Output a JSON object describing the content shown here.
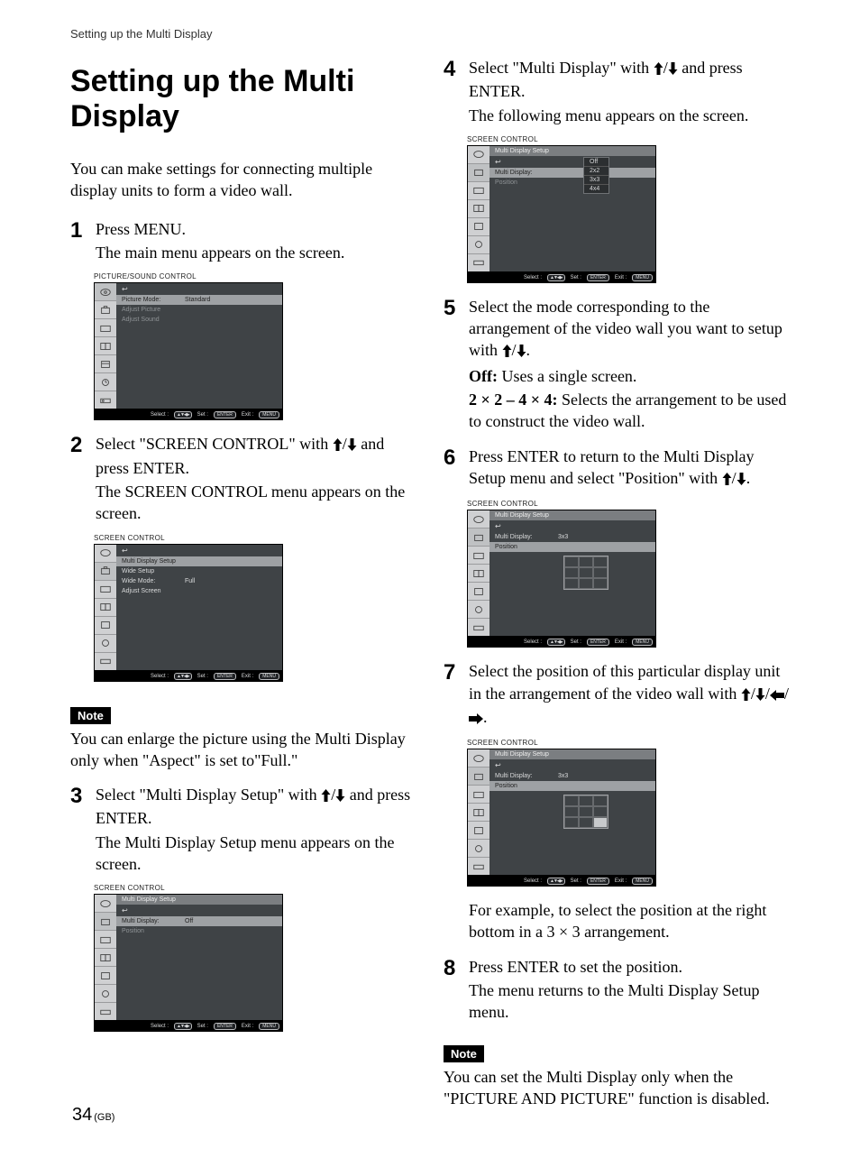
{
  "running_head": "Setting up the Multi Display",
  "title": "Setting up the Multi Display",
  "intro": "You can make settings for connecting multiple display units to form a video wall.",
  "note_label": "Note",
  "note1": "You can enlarge the picture using the Multi Display only when \"Aspect\" is set to\"Full.\"",
  "note2": "You can set the Multi Display only when the \"PICTURE AND PICTURE\" function is disabled.",
  "steps": {
    "s1": {
      "num": "1",
      "main": "Press MENU.",
      "after": "The main menu appears on the screen."
    },
    "s2": {
      "num": "2",
      "pre": "Select \"SCREEN CONTROL\" with ",
      "post": " and press ENTER.",
      "after": "The SCREEN CONTROL menu appears on the screen."
    },
    "s3": {
      "num": "3",
      "pre": "Select \"Multi Display Setup\" with ",
      "post": " and press ENTER.",
      "after": "The Multi Display Setup menu appears on the screen."
    },
    "s4": {
      "num": "4",
      "pre": "Select \"Multi Display\" with ",
      "post": " and press ENTER.",
      "after": "The following menu appears on the screen."
    },
    "s5": {
      "num": "5",
      "line1a": "Select the mode corresponding to the arrangement of the video wall you want to setup with ",
      "line1b": ".",
      "off_label": "Off:",
      "off_text": " Uses a single screen.",
      "range_label": "2 × 2 – 4 × 4:",
      "range_text": " Selects the arrangement to be used to construct the video wall."
    },
    "s6": {
      "num": "6",
      "pre": "Press ENTER to return to the Multi Display Setup menu and select \"Position\" with ",
      "post": "."
    },
    "s7": {
      "num": "7",
      "pre": "Select the position of this particular display unit in the arrangement of the video wall with ",
      "post": "."
    },
    "s8": {
      "num": "8",
      "main": "Press ENTER to set the position.",
      "after": "The menu returns to the Multi Display Setup menu."
    }
  },
  "example_text": "For example, to select the position at the right bottom in a 3 × 3 arrangement.",
  "osd": {
    "picture_sound": {
      "title": "PICTURE/SOUND CONTROL",
      "rows": [
        {
          "label": "Picture Mode:",
          "value": "Standard"
        },
        {
          "label": "Adjust Picture"
        },
        {
          "label": "Adjust Sound"
        }
      ]
    },
    "screen_control": {
      "title": "SCREEN CONTROL",
      "rows": [
        {
          "label": "Multi Display Setup",
          "hi": true
        },
        {
          "label": "Wide Setup"
        },
        {
          "label": "Wide Mode:",
          "value": "Full"
        },
        {
          "label": "Adjust Screen"
        }
      ]
    },
    "mds_off": {
      "title": "SCREEN CONTROL",
      "header": "Multi Display Setup",
      "rows": [
        {
          "label": "Multi Display:",
          "value": "Off",
          "hi": true
        },
        {
          "label": "Position",
          "dim": true
        }
      ]
    },
    "mds_dropdown": {
      "title": "SCREEN CONTROL",
      "header": "Multi Display Setup",
      "rows": [
        {
          "label": "Multi Display:",
          "hi": true
        },
        {
          "label": "Position",
          "dim": true
        }
      ],
      "options": [
        "Off",
        "2x2",
        "3x3",
        "4x4"
      ]
    },
    "mds_pos_blank": {
      "title": "SCREEN CONTROL",
      "header": "Multi Display Setup",
      "rows": [
        {
          "label": "Multi Display:",
          "value": "3x3"
        },
        {
          "label": "Position",
          "hi": true
        }
      ]
    },
    "mds_pos_sel": {
      "title": "SCREEN CONTROL",
      "header": "Multi Display Setup",
      "rows": [
        {
          "label": "Multi Display:",
          "value": "3x3"
        },
        {
          "label": "Position",
          "hi": true
        }
      ]
    },
    "footer": {
      "select": "Select :",
      "set": "Set :",
      "exit": "Exit :",
      "enter": "ENTER",
      "menu": "MENU"
    }
  },
  "page_number": "34",
  "page_region": "(GB)"
}
